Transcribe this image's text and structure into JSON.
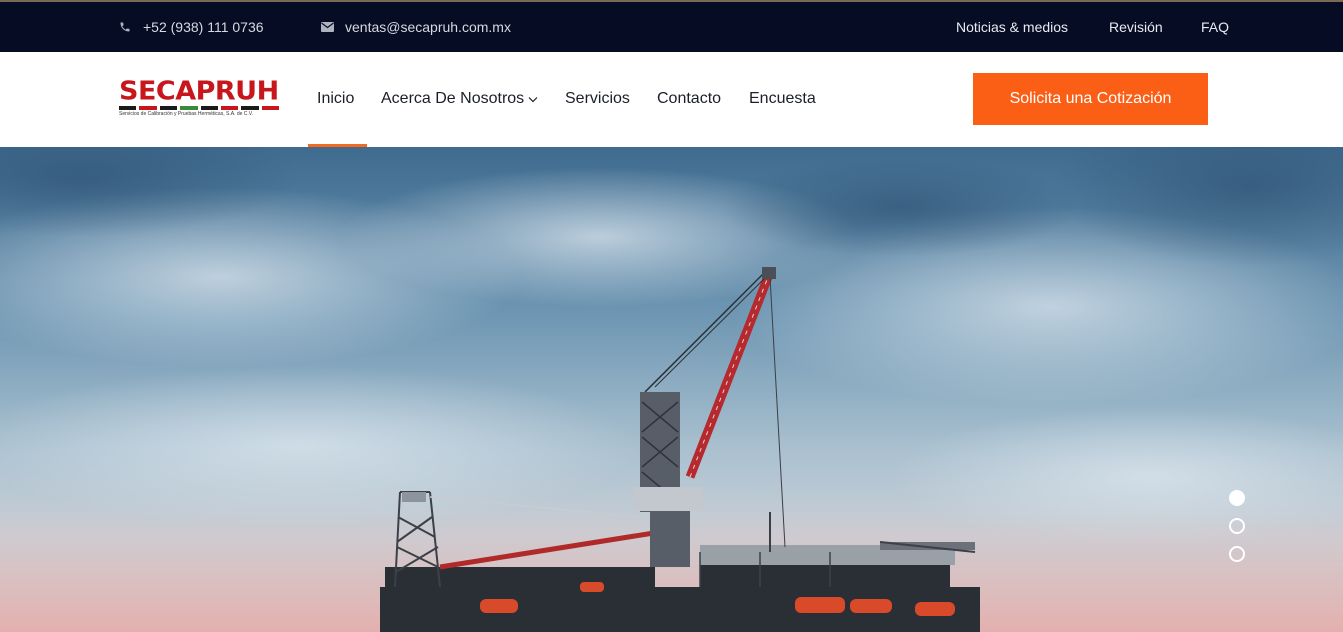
{
  "topbar": {
    "phone": "+52 (938) 111 0736",
    "email": "ventas@secapruh.com.mx",
    "links": [
      "Noticias & medios",
      "Revisión",
      "FAQ"
    ],
    "phone_icon": "phone-icon",
    "email_icon": "envelope-icon"
  },
  "logo": {
    "name": "SECAPRUH",
    "subtitle": "Servicios de Calibración y Pruebas Herméticas, S.A. de C.V.",
    "brand_color": "#c8161d"
  },
  "nav": {
    "items": [
      "Inicio",
      "Acerca De Nosotros",
      "Servicios",
      "Contacto",
      "Encuesta"
    ],
    "active": "Inicio",
    "accent": "#f26b21"
  },
  "cta": {
    "label": "Solicita una Cotización",
    "color": "#fb5f16"
  },
  "hero": {
    "image": "offshore-oil-platform-with-crane",
    "slides": 3,
    "active_slide": 1
  }
}
